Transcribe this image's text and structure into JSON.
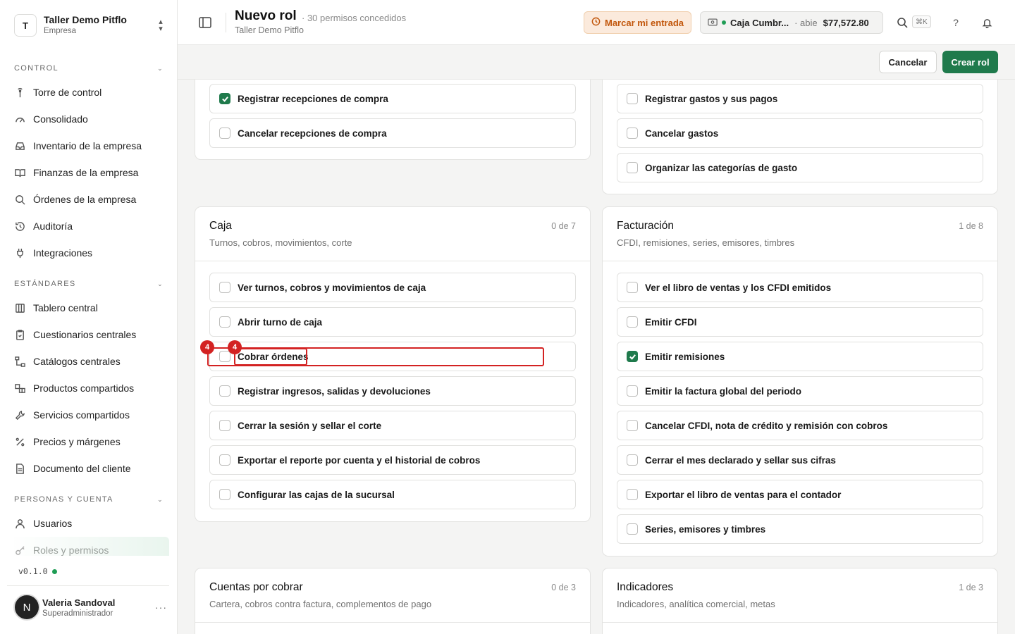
{
  "org": {
    "initial": "T",
    "name": "Taller Demo Pitflo",
    "type": "Empresa"
  },
  "sections": [
    {
      "title": "CONTROL",
      "items": [
        {
          "label": "Torre de control",
          "icon": "tower-icon"
        },
        {
          "label": "Consolidado",
          "icon": "gauge-icon"
        },
        {
          "label": "Inventario de la empresa",
          "icon": "inbox-icon"
        },
        {
          "label": "Finanzas de la empresa",
          "icon": "book-icon"
        },
        {
          "label": "Órdenes de la empresa",
          "icon": "search-icon"
        },
        {
          "label": "Auditoría",
          "icon": "history-icon"
        },
        {
          "label": "Integraciones",
          "icon": "plug-icon"
        }
      ]
    },
    {
      "title": "ESTÁNDARES",
      "items": [
        {
          "label": "Tablero central",
          "icon": "columns-icon"
        },
        {
          "label": "Cuestionarios centrales",
          "icon": "clipboard-icon"
        },
        {
          "label": "Catálogos centrales",
          "icon": "hierarchy-icon"
        },
        {
          "label": "Productos compartidos",
          "icon": "boxes-icon"
        },
        {
          "label": "Servicios compartidos",
          "icon": "wrench-icon"
        },
        {
          "label": "Precios y márgenes",
          "icon": "percent-icon"
        },
        {
          "label": "Documento del cliente",
          "icon": "document-icon"
        }
      ]
    },
    {
      "title": "PERSONAS Y CUENTA",
      "items": [
        {
          "label": "Usuarios",
          "icon": "user-icon"
        },
        {
          "label": "Roles y permisos",
          "icon": "key-icon"
        }
      ]
    }
  ],
  "version": "v0.1.0",
  "user": {
    "initial": "N",
    "name": "Valeria Sandoval",
    "role": "Superadministrador"
  },
  "header": {
    "title": "Nuevo rol",
    "meta": "· 30 permisos concedidos",
    "subtitle": "Taller Demo Pitflo",
    "entry_button": "Marcar mi entrada",
    "cash_name": "Caja Cumbr...",
    "cash_state": "· abie",
    "cash_amount": "$77,572.80",
    "shortcut": "⌘K"
  },
  "actions": {
    "cancel": "Cancelar",
    "create": "Crear rol"
  },
  "cards": {
    "compras": {
      "perms": [
        {
          "label": "Registrar recepciones de compra",
          "checked": true
        },
        {
          "label": "Cancelar recepciones de compra",
          "checked": false
        }
      ]
    },
    "gastos": {
      "perms": [
        {
          "label": "Registrar gastos y sus pagos",
          "checked": false
        },
        {
          "label": "Cancelar gastos",
          "checked": false
        },
        {
          "label": "Organizar las categorías de gasto",
          "checked": false
        }
      ]
    },
    "caja": {
      "title": "Caja",
      "desc": "Turnos, cobros, movimientos, corte",
      "count": "0 de 7",
      "perms": [
        {
          "label": "Ver turnos, cobros y movimientos de caja",
          "checked": false
        },
        {
          "label": "Abrir turno de caja",
          "checked": false
        },
        {
          "label": "Cobrar órdenes",
          "checked": false
        },
        {
          "label": "Registrar ingresos, salidas y devoluciones",
          "checked": false
        },
        {
          "label": "Cerrar la sesión y sellar el corte",
          "checked": false
        },
        {
          "label": "Exportar el reporte por cuenta y el historial de cobros",
          "checked": false
        },
        {
          "label": "Configurar las cajas de la sucursal",
          "checked": false
        }
      ]
    },
    "facturacion": {
      "title": "Facturación",
      "desc": "CFDI, remisiones, series, emisores, timbres",
      "count": "1 de 8",
      "perms": [
        {
          "label": "Ver el libro de ventas y los CFDI emitidos",
          "checked": false
        },
        {
          "label": "Emitir CFDI",
          "checked": false
        },
        {
          "label": "Emitir remisiones",
          "checked": true
        },
        {
          "label": "Emitir la factura global del periodo",
          "checked": false
        },
        {
          "label": "Cancelar CFDI, nota de crédito y remisión con cobros",
          "checked": false
        },
        {
          "label": "Cerrar el mes declarado y sellar sus cifras",
          "checked": false
        },
        {
          "label": "Exportar el libro de ventas para el contador",
          "checked": false
        },
        {
          "label": "Series, emisores y timbres",
          "checked": false
        }
      ]
    },
    "cxc": {
      "title": "Cuentas por cobrar",
      "desc": "Cartera, cobros contra factura, complementos de pago",
      "count": "0 de 3"
    },
    "indicadores": {
      "title": "Indicadores",
      "desc": "Indicadores, analítica comercial, metas",
      "count": "1 de 3"
    }
  },
  "annotations": {
    "badge_a": "4",
    "badge_b": "4"
  },
  "colors": {
    "accent": "#1f7a4c",
    "warning_bg": "#fbeadc",
    "warning_text": "#c2570c",
    "annotation": "#d32222"
  }
}
